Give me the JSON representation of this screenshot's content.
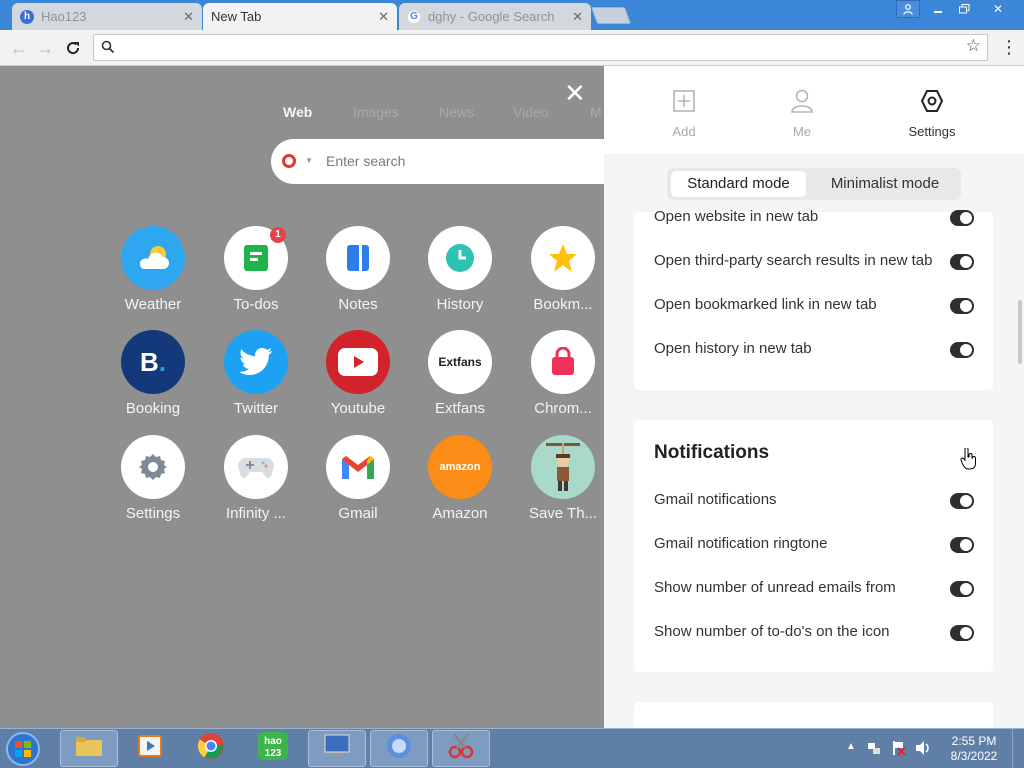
{
  "browser": {
    "tabs": [
      {
        "title": "Hao123",
        "active": false,
        "favicon": "hao123-icon"
      },
      {
        "title": "New Tab",
        "active": true,
        "favicon": ""
      },
      {
        "title": "dghy - Google Search",
        "active": false,
        "favicon": "google-icon"
      }
    ],
    "address": {
      "value": "",
      "placeholder": ""
    }
  },
  "newtab": {
    "search_tabs": [
      "Web",
      "Images",
      "News",
      "Video",
      "M"
    ],
    "search_placeholder": "Enter search",
    "apps": [
      {
        "label": "Weather",
        "icon": "weather-icon",
        "badge": ""
      },
      {
        "label": "To-dos",
        "icon": "todo-icon",
        "badge": "1"
      },
      {
        "label": "Notes",
        "icon": "notes-icon",
        "badge": ""
      },
      {
        "label": "History",
        "icon": "history-clock-icon",
        "badge": ""
      },
      {
        "label": "Bookm...",
        "icon": "bookmark-star-icon",
        "badge": ""
      },
      {
        "label": "Booking",
        "icon": "booking-icon",
        "badge": ""
      },
      {
        "label": "Twitter",
        "icon": "twitter-icon",
        "badge": ""
      },
      {
        "label": "Youtube",
        "icon": "youtube-icon",
        "badge": ""
      },
      {
        "label": "Extfans",
        "icon": "extfans-icon",
        "badge": ""
      },
      {
        "label": "Chrom...",
        "icon": "chrome-store-icon",
        "badge": ""
      },
      {
        "label": "Settings",
        "icon": "gear-icon",
        "badge": ""
      },
      {
        "label": "Infinity ...",
        "icon": "gamepad-icon",
        "badge": ""
      },
      {
        "label": "Gmail",
        "icon": "gmail-icon",
        "badge": ""
      },
      {
        "label": "Amazon",
        "icon": "amazon-icon",
        "badge": ""
      },
      {
        "label": "Save Th...",
        "icon": "game-character-icon",
        "badge": ""
      }
    ],
    "extfans_text": "Extfans",
    "amazon_text": "amazon"
  },
  "panel": {
    "top_tabs": [
      {
        "label": "Add",
        "icon": "add-square-icon"
      },
      {
        "label": "Me",
        "icon": "user-icon"
      },
      {
        "label": "Settings",
        "icon": "settings-hexagon-icon"
      }
    ],
    "modes": {
      "standard": "Standard mode",
      "minimalist": "Minimalist mode"
    },
    "open_section": {
      "rows": [
        {
          "label": "Open website in new tab",
          "on": true
        },
        {
          "label": "Open third-party search results in new tab",
          "on": true
        },
        {
          "label": "Open bookmarked link in new tab",
          "on": true
        },
        {
          "label": "Open history in new tab",
          "on": true
        }
      ]
    },
    "notifications": {
      "title": "Notifications",
      "rows": [
        {
          "label": "Gmail notifications",
          "on": true
        },
        {
          "label": "Gmail notification ringtone",
          "on": true
        },
        {
          "label": "Show number of unread emails from",
          "on": true
        },
        {
          "label": "Show number of to-do's on the icon",
          "on": true
        }
      ]
    }
  },
  "taskbar": {
    "clock_time": "2:55 PM",
    "clock_date": "8/3/2022"
  },
  "colors": {
    "accent_blue": "#3c86d8",
    "overlay_gray": "#8f8f8f",
    "toggle_dark": "#2e2e2e"
  }
}
